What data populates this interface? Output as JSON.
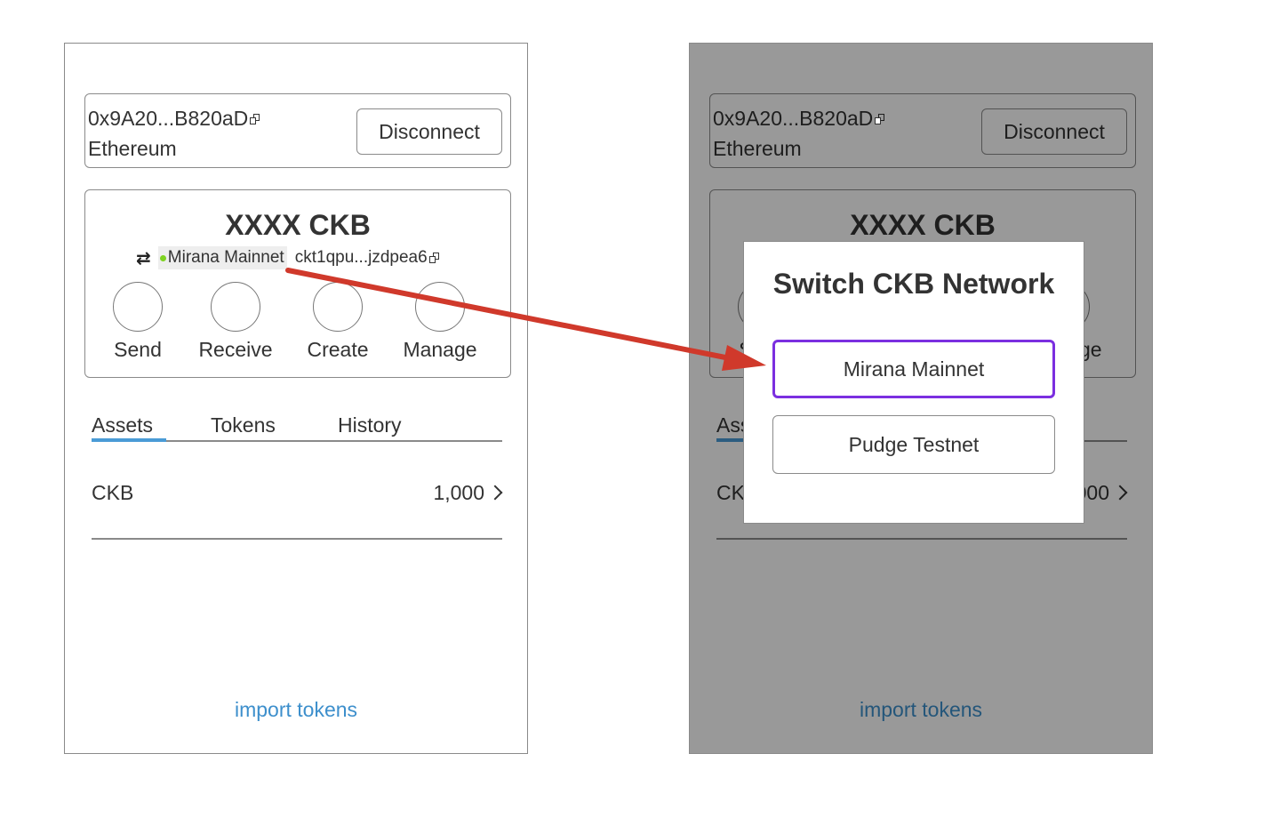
{
  "wallet": {
    "address": "0x9A20...B820aD",
    "chain": "Ethereum",
    "disconnect_label": "Disconnect"
  },
  "balance": {
    "amount": "XXXX CKB",
    "network_name": "Mirana Mainnet",
    "ckb_address": "ckt1qpu...jzdpea6",
    "switch_icon": "⇄"
  },
  "actions": [
    {
      "label": "Send"
    },
    {
      "label": "Receive"
    },
    {
      "label": "Create"
    },
    {
      "label": "Manage"
    }
  ],
  "tabs": [
    {
      "label": "Assets",
      "active": true
    },
    {
      "label": "Tokens",
      "active": false
    },
    {
      "label": "History",
      "active": false
    }
  ],
  "assets": [
    {
      "name": "CKB",
      "amount": "1,000"
    }
  ],
  "import_tokens_label": "import tokens",
  "modal": {
    "title": "Switch CKB Network",
    "options": [
      {
        "label": "Mirana Mainnet",
        "selected": true
      },
      {
        "label": "Pudge Testnet",
        "selected": false
      }
    ]
  },
  "colors": {
    "accent_link": "#3d8fcc",
    "tab_indicator": "#4a9bd6",
    "selected_border": "#7b2fe0",
    "status_dot": "#7ed321",
    "arrow": "#d0392b",
    "overlay": "rgba(0,0,0,0.4)"
  },
  "icons": [
    "copy-icon",
    "switch-network-icon",
    "chevron-right-icon",
    "arrow-annotation"
  ]
}
